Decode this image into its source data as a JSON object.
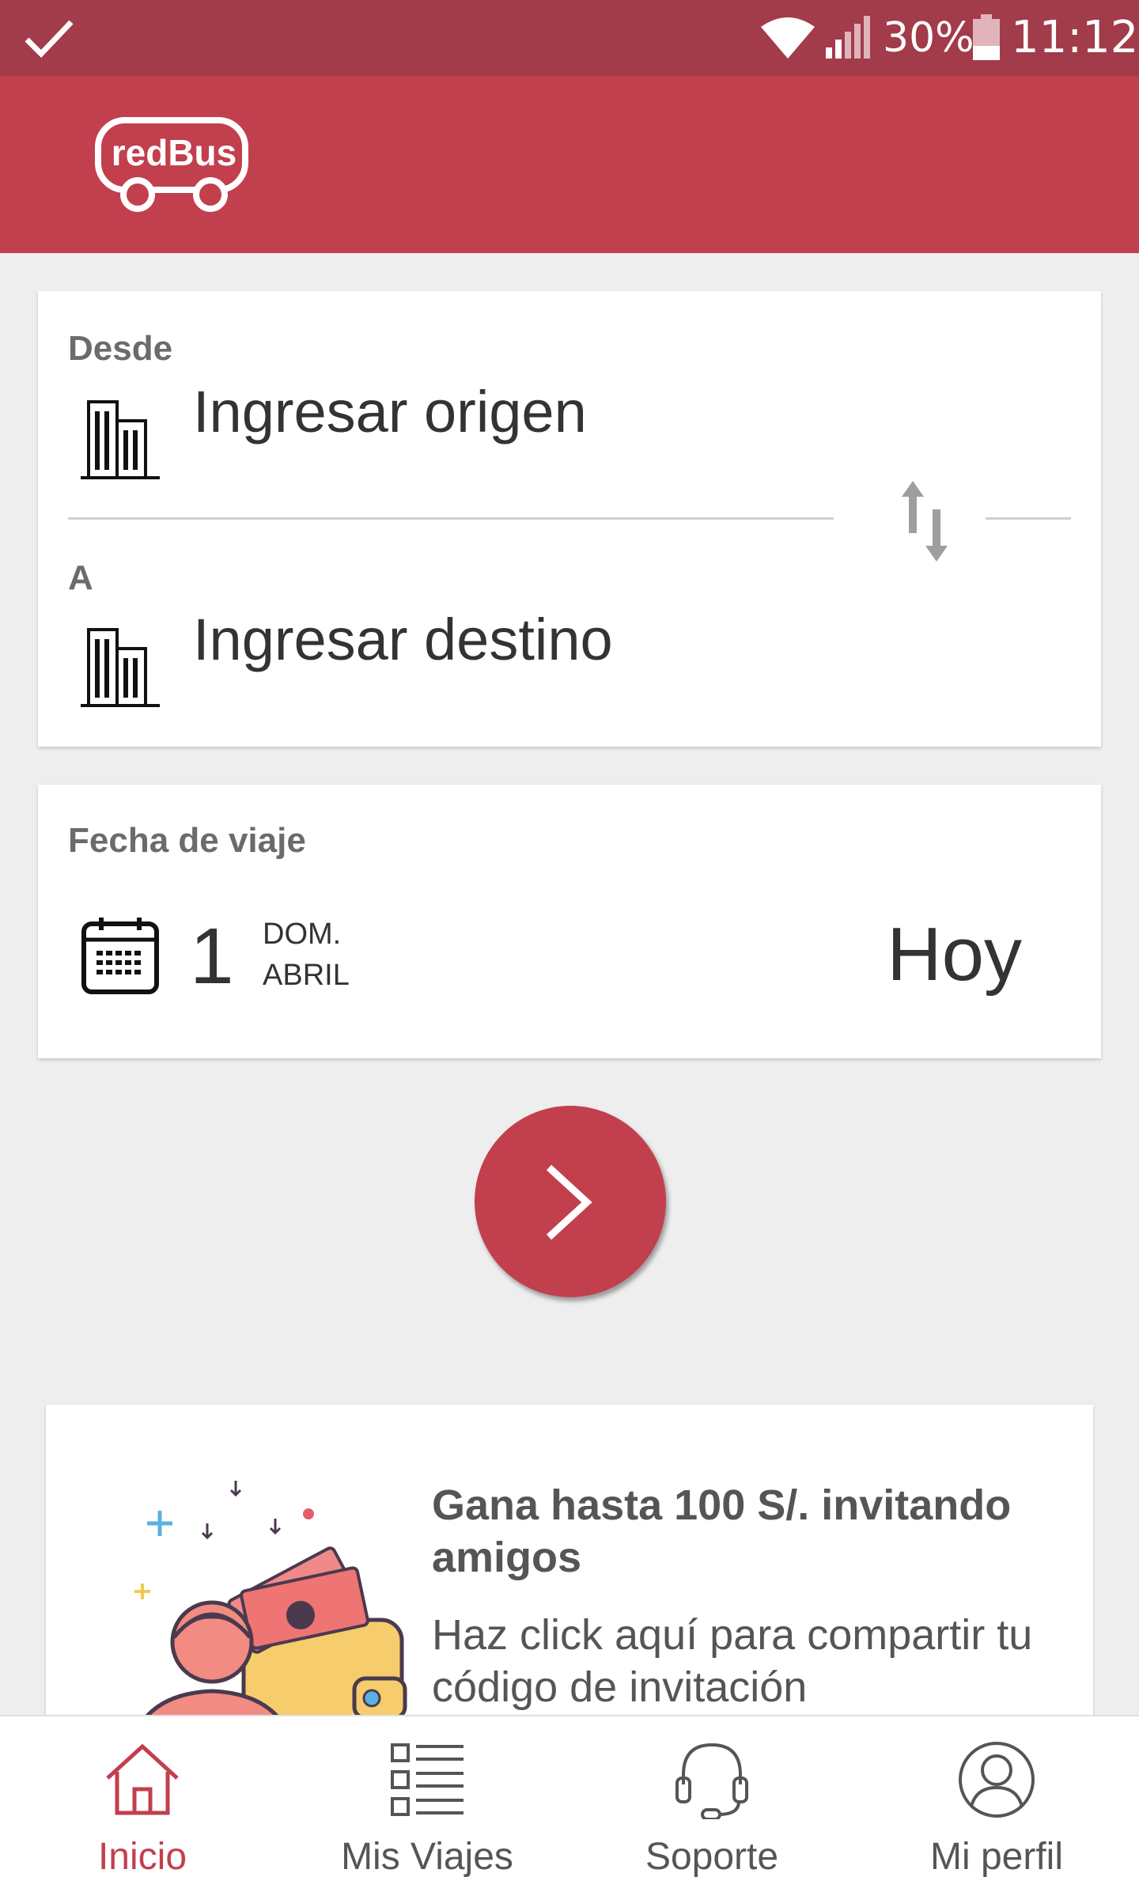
{
  "status_bar": {
    "battery_percent": "30%",
    "time": "11:12",
    "icons": [
      "check-icon",
      "wifi-icon",
      "signal-icon",
      "battery-icon"
    ]
  },
  "app_bar": {
    "logo_text": "redBus",
    "color": "#c23f4e"
  },
  "route": {
    "from_label": "Desde",
    "from_placeholder": "Ingresar origen",
    "to_label": "A",
    "to_placeholder": "Ingresar destino"
  },
  "travel_date": {
    "label": "Fecha de viaje",
    "day": "1",
    "weekday": "DOM.",
    "month": "ABRIL",
    "relative": "Hoy"
  },
  "promo": {
    "title": "Gana hasta 100 S/. invitando amigos",
    "text": "Haz click aquí para compartir tu código de invitación"
  },
  "bottom_nav": {
    "items": [
      {
        "label": "Inicio",
        "icon": "home-icon",
        "active": true
      },
      {
        "label": "Mis Viajes",
        "icon": "list-icon",
        "active": false
      },
      {
        "label": "Soporte",
        "icon": "headset-icon",
        "active": false
      },
      {
        "label": "Mi perfil",
        "icon": "profile-icon",
        "active": false
      }
    ]
  },
  "colors": {
    "status_bar": "#a23b4a",
    "brand_red": "#c23f4e",
    "background": "#eeeeee"
  }
}
